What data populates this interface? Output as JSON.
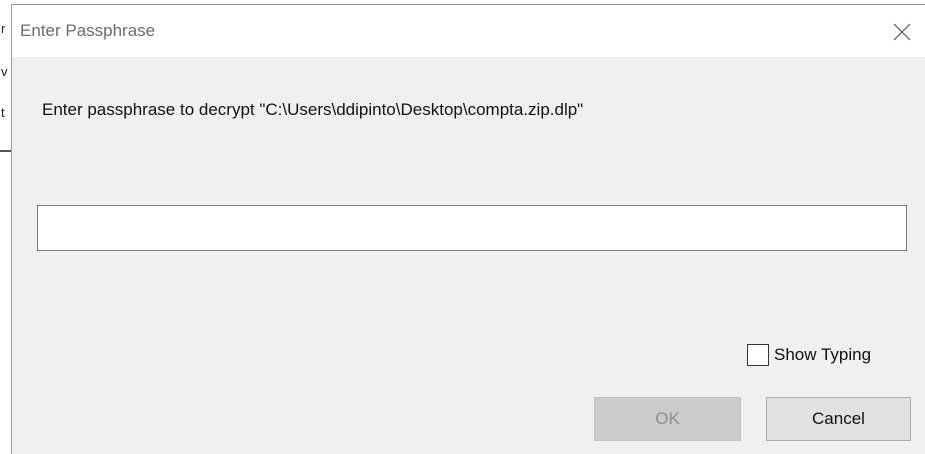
{
  "background": {
    "glyphs": [
      "r",
      "v",
      "t"
    ]
  },
  "dialog": {
    "title": "Enter Passphrase",
    "close_icon": "close-icon",
    "prompt": "Enter passphrase to decrypt \"C:\\Users\\ddipinto\\Desktop\\compta.zip.dlp\"",
    "passphrase": {
      "value": "",
      "placeholder": ""
    },
    "show_typing": {
      "label": "Show Typing",
      "checked": false
    },
    "buttons": {
      "ok_label": "OK",
      "ok_enabled": false,
      "cancel_label": "Cancel"
    }
  },
  "colors": {
    "dialog_bg": "#f0f0f0",
    "titlebar_bg": "#ffffff",
    "title_text": "#6b6b6b",
    "disabled_button_bg": "#cccccc",
    "button_bg": "#e1e1e1"
  }
}
